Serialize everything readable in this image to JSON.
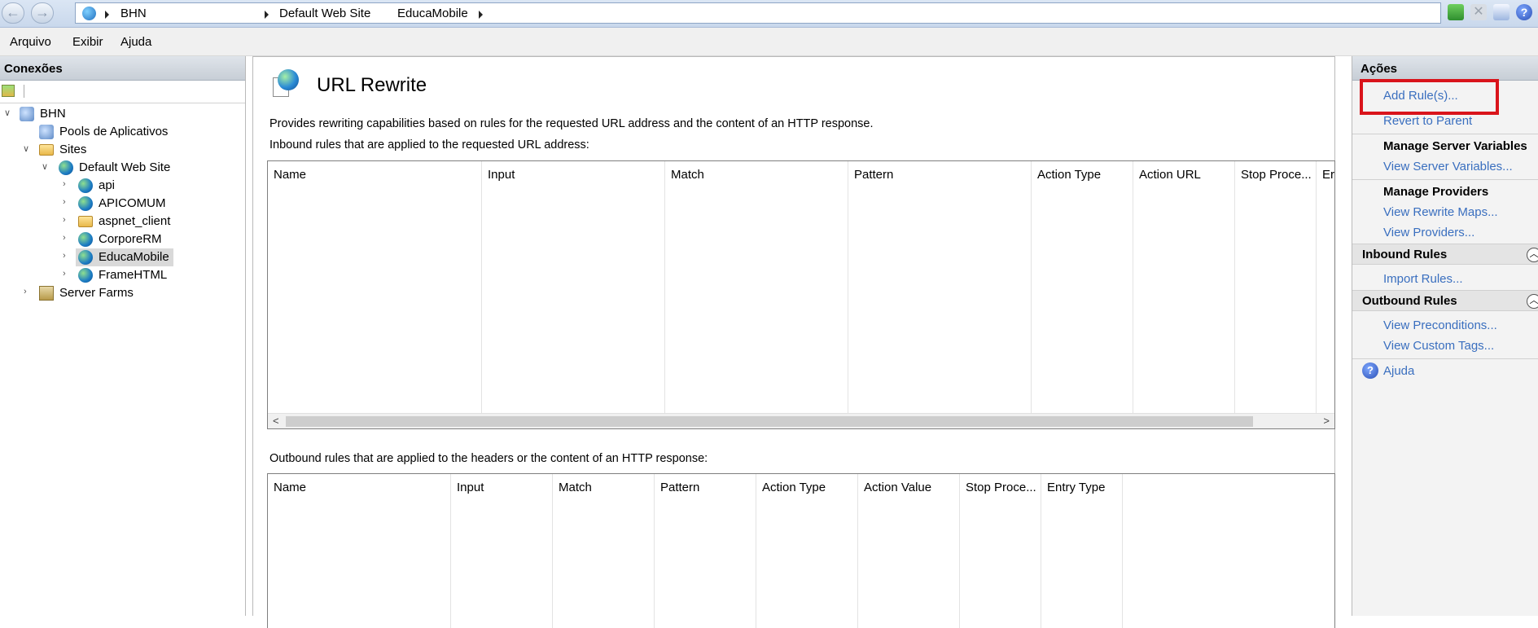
{
  "address_bar": {
    "segments": [
      "BHN",
      "Default Web Site",
      "EducaMobile"
    ],
    "back_icon": "back-arrow-icon",
    "forward_icon": "forward-arrow-icon"
  },
  "menu": [
    "Arquivo",
    "Exibir",
    "Ajuda"
  ],
  "connections": {
    "title": "Conexões",
    "tree": [
      {
        "label": "BHN",
        "level": 0,
        "icon": "server-icon",
        "expander": "expanded"
      },
      {
        "label": "Pools de Aplicativos",
        "level": 1,
        "icon": "app-pool-icon",
        "expander": "none"
      },
      {
        "label": "Sites",
        "level": 1,
        "icon": "sites-folder-icon",
        "expander": "expanded"
      },
      {
        "label": "Default Web Site",
        "level": 2,
        "icon": "globe-icon",
        "expander": "expanded"
      },
      {
        "label": "api",
        "level": 3,
        "icon": "web-app-icon",
        "expander": "collapsed"
      },
      {
        "label": "APICOMUM",
        "level": 3,
        "icon": "web-app-icon",
        "expander": "collapsed"
      },
      {
        "label": "aspnet_client",
        "level": 3,
        "icon": "folder-icon",
        "expander": "collapsed"
      },
      {
        "label": "CorporeRM",
        "level": 3,
        "icon": "web-app-icon",
        "expander": "collapsed"
      },
      {
        "label": "EducaMobile",
        "level": 3,
        "icon": "web-app-icon",
        "expander": "collapsed",
        "selected": true
      },
      {
        "label": "FrameHTML",
        "level": 3,
        "icon": "web-app-icon",
        "expander": "collapsed"
      },
      {
        "label": "Server Farms",
        "level": 1,
        "icon": "server-farm-icon",
        "expander": "collapsed"
      }
    ]
  },
  "feature": {
    "title": "URL Rewrite",
    "description": "Provides rewriting capabilities based on rules for the requested URL address and the content of an HTTP response.",
    "inbound_label": "Inbound rules that are applied to the requested URL address:",
    "inbound_columns": [
      "Name",
      "Input",
      "Match",
      "Pattern",
      "Action Type",
      "Action URL",
      "Stop Proce...",
      "Er"
    ],
    "outbound_label": "Outbound rules that are applied to the headers or the content of an HTTP response:",
    "outbound_columns": [
      "Name",
      "Input",
      "Match",
      "Pattern",
      "Action Type",
      "Action Value",
      "Stop Proce...",
      "Entry Type"
    ]
  },
  "actions": {
    "title": "Ações",
    "add_rules": "Add Rule(s)...",
    "revert": "Revert to Parent",
    "manage_server_vars": "Manage Server Variables",
    "view_server_vars": "View Server Variables...",
    "manage_providers": "Manage Providers",
    "view_rewrite_maps": "View Rewrite Maps...",
    "view_providers": "View Providers...",
    "inbound_rules": "Inbound Rules",
    "import_rules": "Import Rules...",
    "outbound_rules": "Outbound Rules",
    "view_preconditions": "View Preconditions...",
    "view_custom_tags": "View Custom Tags...",
    "help": "Ajuda"
  },
  "colors": {
    "link": "#3a6fbf",
    "highlight": "#d9141b"
  }
}
